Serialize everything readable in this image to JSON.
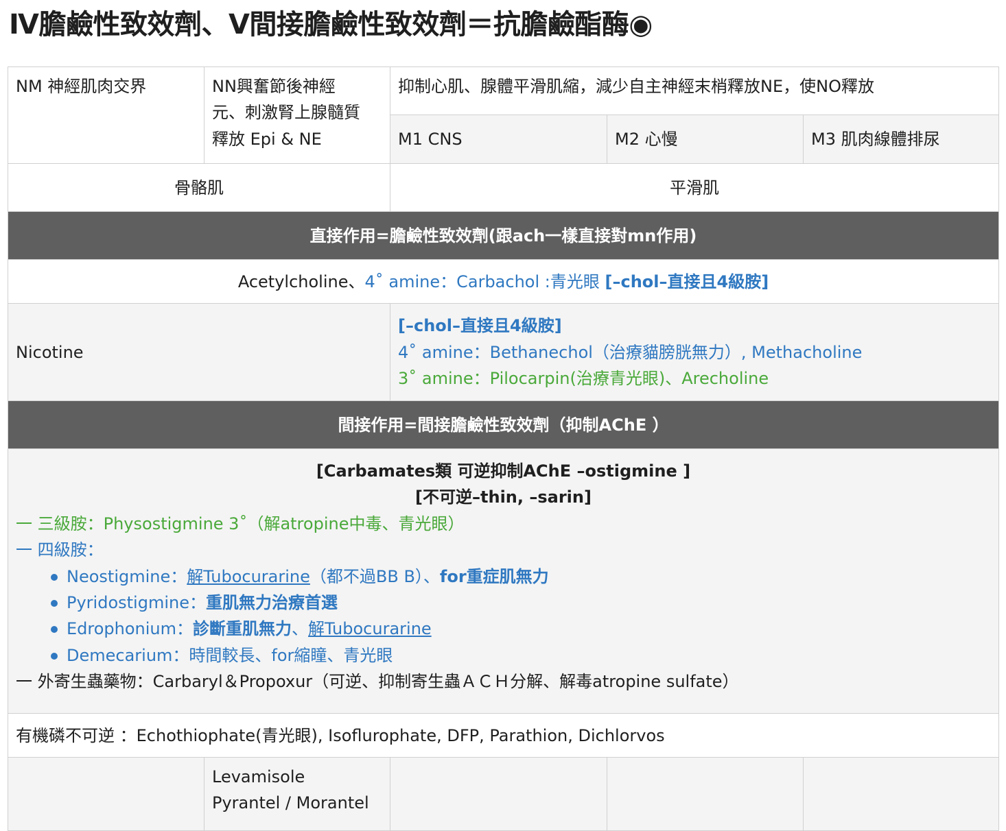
{
  "title": "Ⅳ膽鹼性致效劑、Ⅴ間接膽鹼性致效劑＝抗膽鹼酯酶◉",
  "colors": {
    "blue": "#2f78c1",
    "green": "#4aa93a",
    "header_bg": "#5f5f5f",
    "row_gray": "#f4f4f4"
  },
  "receptors": {
    "nm": "NM 神經肌肉交界",
    "nn": [
      "NN興奮節後神經",
      "元、刺激腎上腺髓質",
      "釋放 Epi & NE"
    ],
    "muscarinic_effect": "抑制心肌、腺體平滑肌縮，減少自主神經末梢釋放NE，使NO釋放",
    "m1": "M1 CNS",
    "m2": "M2 心慢",
    "m3": "M3 肌肉線體排尿"
  },
  "muscle_types": {
    "skeletal": "骨骼肌",
    "smooth": "平滑肌"
  },
  "direct": {
    "header": "直接作用=膽鹼性致效劑(跟ach一樣直接對mn作用)",
    "row": {
      "plain": "Acetylcholine、",
      "blue": "4˚ amine：Carbachol :青光眼 ",
      "blue_bold": "[–chol–直接且4級胺]"
    },
    "nicotine": "Nicotine",
    "chol_rule": "[–chol–直接且4級胺]",
    "amine4": "4˚ amine：Bethanechol（治療貓膀胱無力）, Methacholine",
    "amine3": "3˚ amine：Pilocarpin(治療青光眼)、Arecholine"
  },
  "indirect": {
    "header": "間接作用=間接膽鹼性致效劑（抑制AChE ）",
    "carbamates": "[Carbamates類 可逆抑制AChE  –ostigmine ]",
    "irreversible": "[不可逆–thin, –sarin]",
    "tertiary": "一 三級胺：Physostigmine 3˚（解atropine中毒、青光眼）",
    "quaternary": "一 四級胺：",
    "drugs": [
      {
        "name": "Neostigmine：",
        "link": "解Tubocurarine",
        "text": "（都不過BB B）、",
        "bold": "for重症肌無力"
      },
      {
        "name": "Pyridostigmine：",
        "bold": "重肌無力治療首選"
      },
      {
        "name": "Edrophonium：",
        "bold": "診斷重肌無力",
        "text": "、",
        "link": "解Tubocurarine"
      },
      {
        "name": "Demecarium：時間較長、for縮瞳、青光眼"
      }
    ],
    "antiparasitic": "一 外寄生蟲藥物：Carbaryl＆Propoxur（可逆、抑制寄生蟲ＡＣＨ分解、解毒atropine sulfate）",
    "organophosphate": "有機磷不可逆 ：Echothiophate(青光眼), Isoflurophate, DFP, Parathion, Dichlorvos",
    "nicotinic_agonists": [
      "Levamisole",
      "Pyrantel / Morantel"
    ]
  }
}
